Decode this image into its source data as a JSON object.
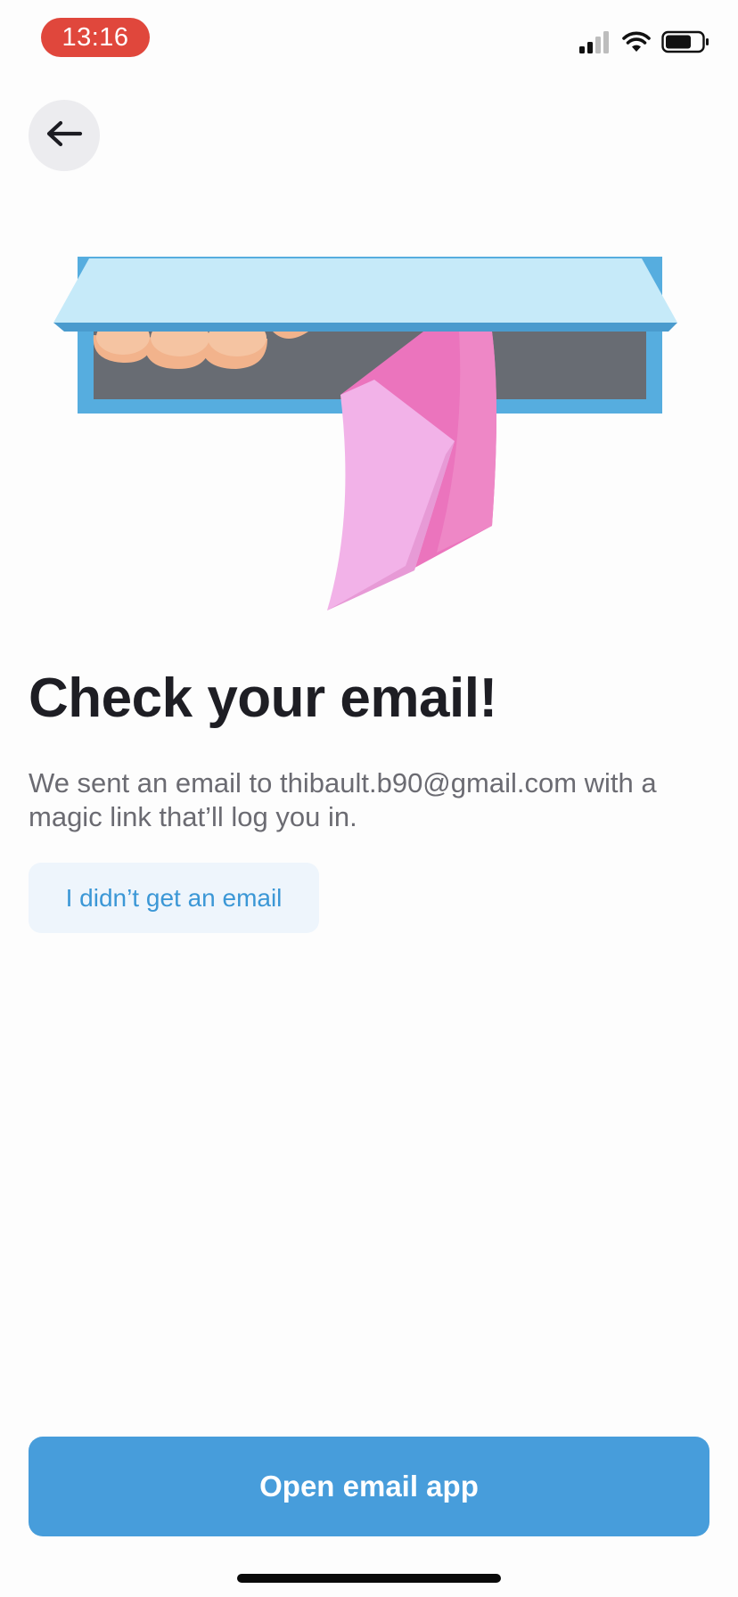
{
  "status_bar": {
    "time": "13:16",
    "icons": [
      "cellular-signal-icon",
      "wifi-icon",
      "battery-icon"
    ]
  },
  "nav": {
    "back_icon": "arrow-left-icon"
  },
  "illustration": {
    "subject": "mail-slot-envelope"
  },
  "content": {
    "title": "Check your email!",
    "message": "We sent an email to thibault.b90@gmail.com with a magic link that’ll log you in.",
    "resend_label": "I didn’t get an email"
  },
  "footer": {
    "open_app_label": "Open email app"
  },
  "colors": {
    "accent": "#479ddb",
    "link": "#3b97d6",
    "time_pill": "#e0473c",
    "title": "#1e1e24",
    "body": "#6b6b72"
  }
}
